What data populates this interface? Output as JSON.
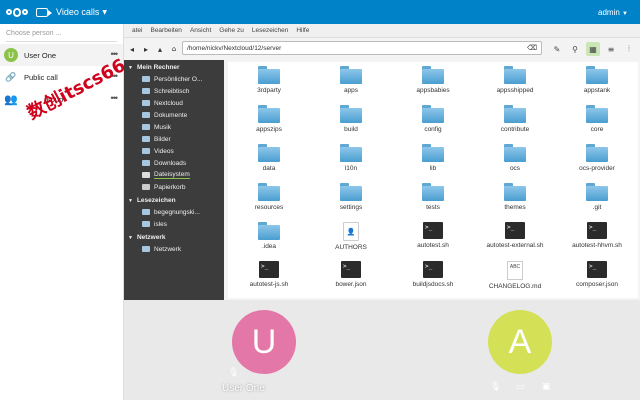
{
  "topbar": {
    "app_title": "Video calls",
    "user": "admin",
    "accent": "#0082c9"
  },
  "sidebar": {
    "search_placeholder": "Choose person ...",
    "rooms": [
      {
        "label": "User One",
        "avatar": "U",
        "avatar_color": "#8bc34a"
      },
      {
        "label": "Public call",
        "icon": "link-icon"
      },
      {
        "label": "group",
        "icon": "group-icon"
      }
    ],
    "watermark": "数创itscs66"
  },
  "file_manager": {
    "menu": [
      "atei",
      "Bearbeiten",
      "Ansicht",
      "Gehe zu",
      "Lesezeichen",
      "Hilfe"
    ],
    "path": "/home/nickv/Nextcloud/12/server",
    "sections": [
      {
        "title": "Mein Rechner",
        "items": [
          "Persönlicher O...",
          "Schreibtisch",
          "Nextcloud",
          "Dokumente",
          "Musik",
          "Bilder",
          "Videos",
          "Downloads",
          "Dateisystem",
          "Papierkorb"
        ]
      },
      {
        "title": "Lesezeichen",
        "items": [
          "begegnungski...",
          "isles"
        ]
      },
      {
        "title": "Netzwerk",
        "items": [
          "Netzwerk"
        ]
      }
    ],
    "selected_place": "Dateisystem",
    "files": [
      {
        "name": "3rdparty",
        "type": "folder"
      },
      {
        "name": "apps",
        "type": "folder"
      },
      {
        "name": "appsbabies",
        "type": "folder"
      },
      {
        "name": "appsshipped",
        "type": "folder"
      },
      {
        "name": "appstank",
        "type": "folder"
      },
      {
        "name": "appszips",
        "type": "folder"
      },
      {
        "name": "build",
        "type": "folder"
      },
      {
        "name": "config",
        "type": "folder"
      },
      {
        "name": "contribute",
        "type": "folder"
      },
      {
        "name": "core",
        "type": "folder"
      },
      {
        "name": "data",
        "type": "folder"
      },
      {
        "name": "l10n",
        "type": "folder"
      },
      {
        "name": "lib",
        "type": "folder"
      },
      {
        "name": "ocs",
        "type": "folder"
      },
      {
        "name": "ocs-provider",
        "type": "folder"
      },
      {
        "name": "resources",
        "type": "folder"
      },
      {
        "name": "settings",
        "type": "folder"
      },
      {
        "name": "tests",
        "type": "folder"
      },
      {
        "name": "themes",
        "type": "folder"
      },
      {
        "name": ".git",
        "type": "folder"
      },
      {
        "name": ".idea",
        "type": "folder"
      },
      {
        "name": "AUTHORS",
        "type": "doc"
      },
      {
        "name": "autotest.sh",
        "type": "script"
      },
      {
        "name": "autotest-external.sh",
        "type": "script"
      },
      {
        "name": "autotest-hhvm.sh",
        "type": "script"
      },
      {
        "name": "autotest-js.sh",
        "type": "script"
      },
      {
        "name": "bower.json",
        "type": "script"
      },
      {
        "name": "buildjsdocs.sh",
        "type": "script"
      },
      {
        "name": "CHANGELOG.md",
        "type": "text"
      },
      {
        "name": "composer.json",
        "type": "script"
      }
    ]
  },
  "call": {
    "participants": [
      {
        "name": "User One",
        "initial": "U",
        "color": "#e377a8"
      },
      {
        "name": "",
        "initial": "A",
        "color": "#d4e157"
      }
    ]
  }
}
